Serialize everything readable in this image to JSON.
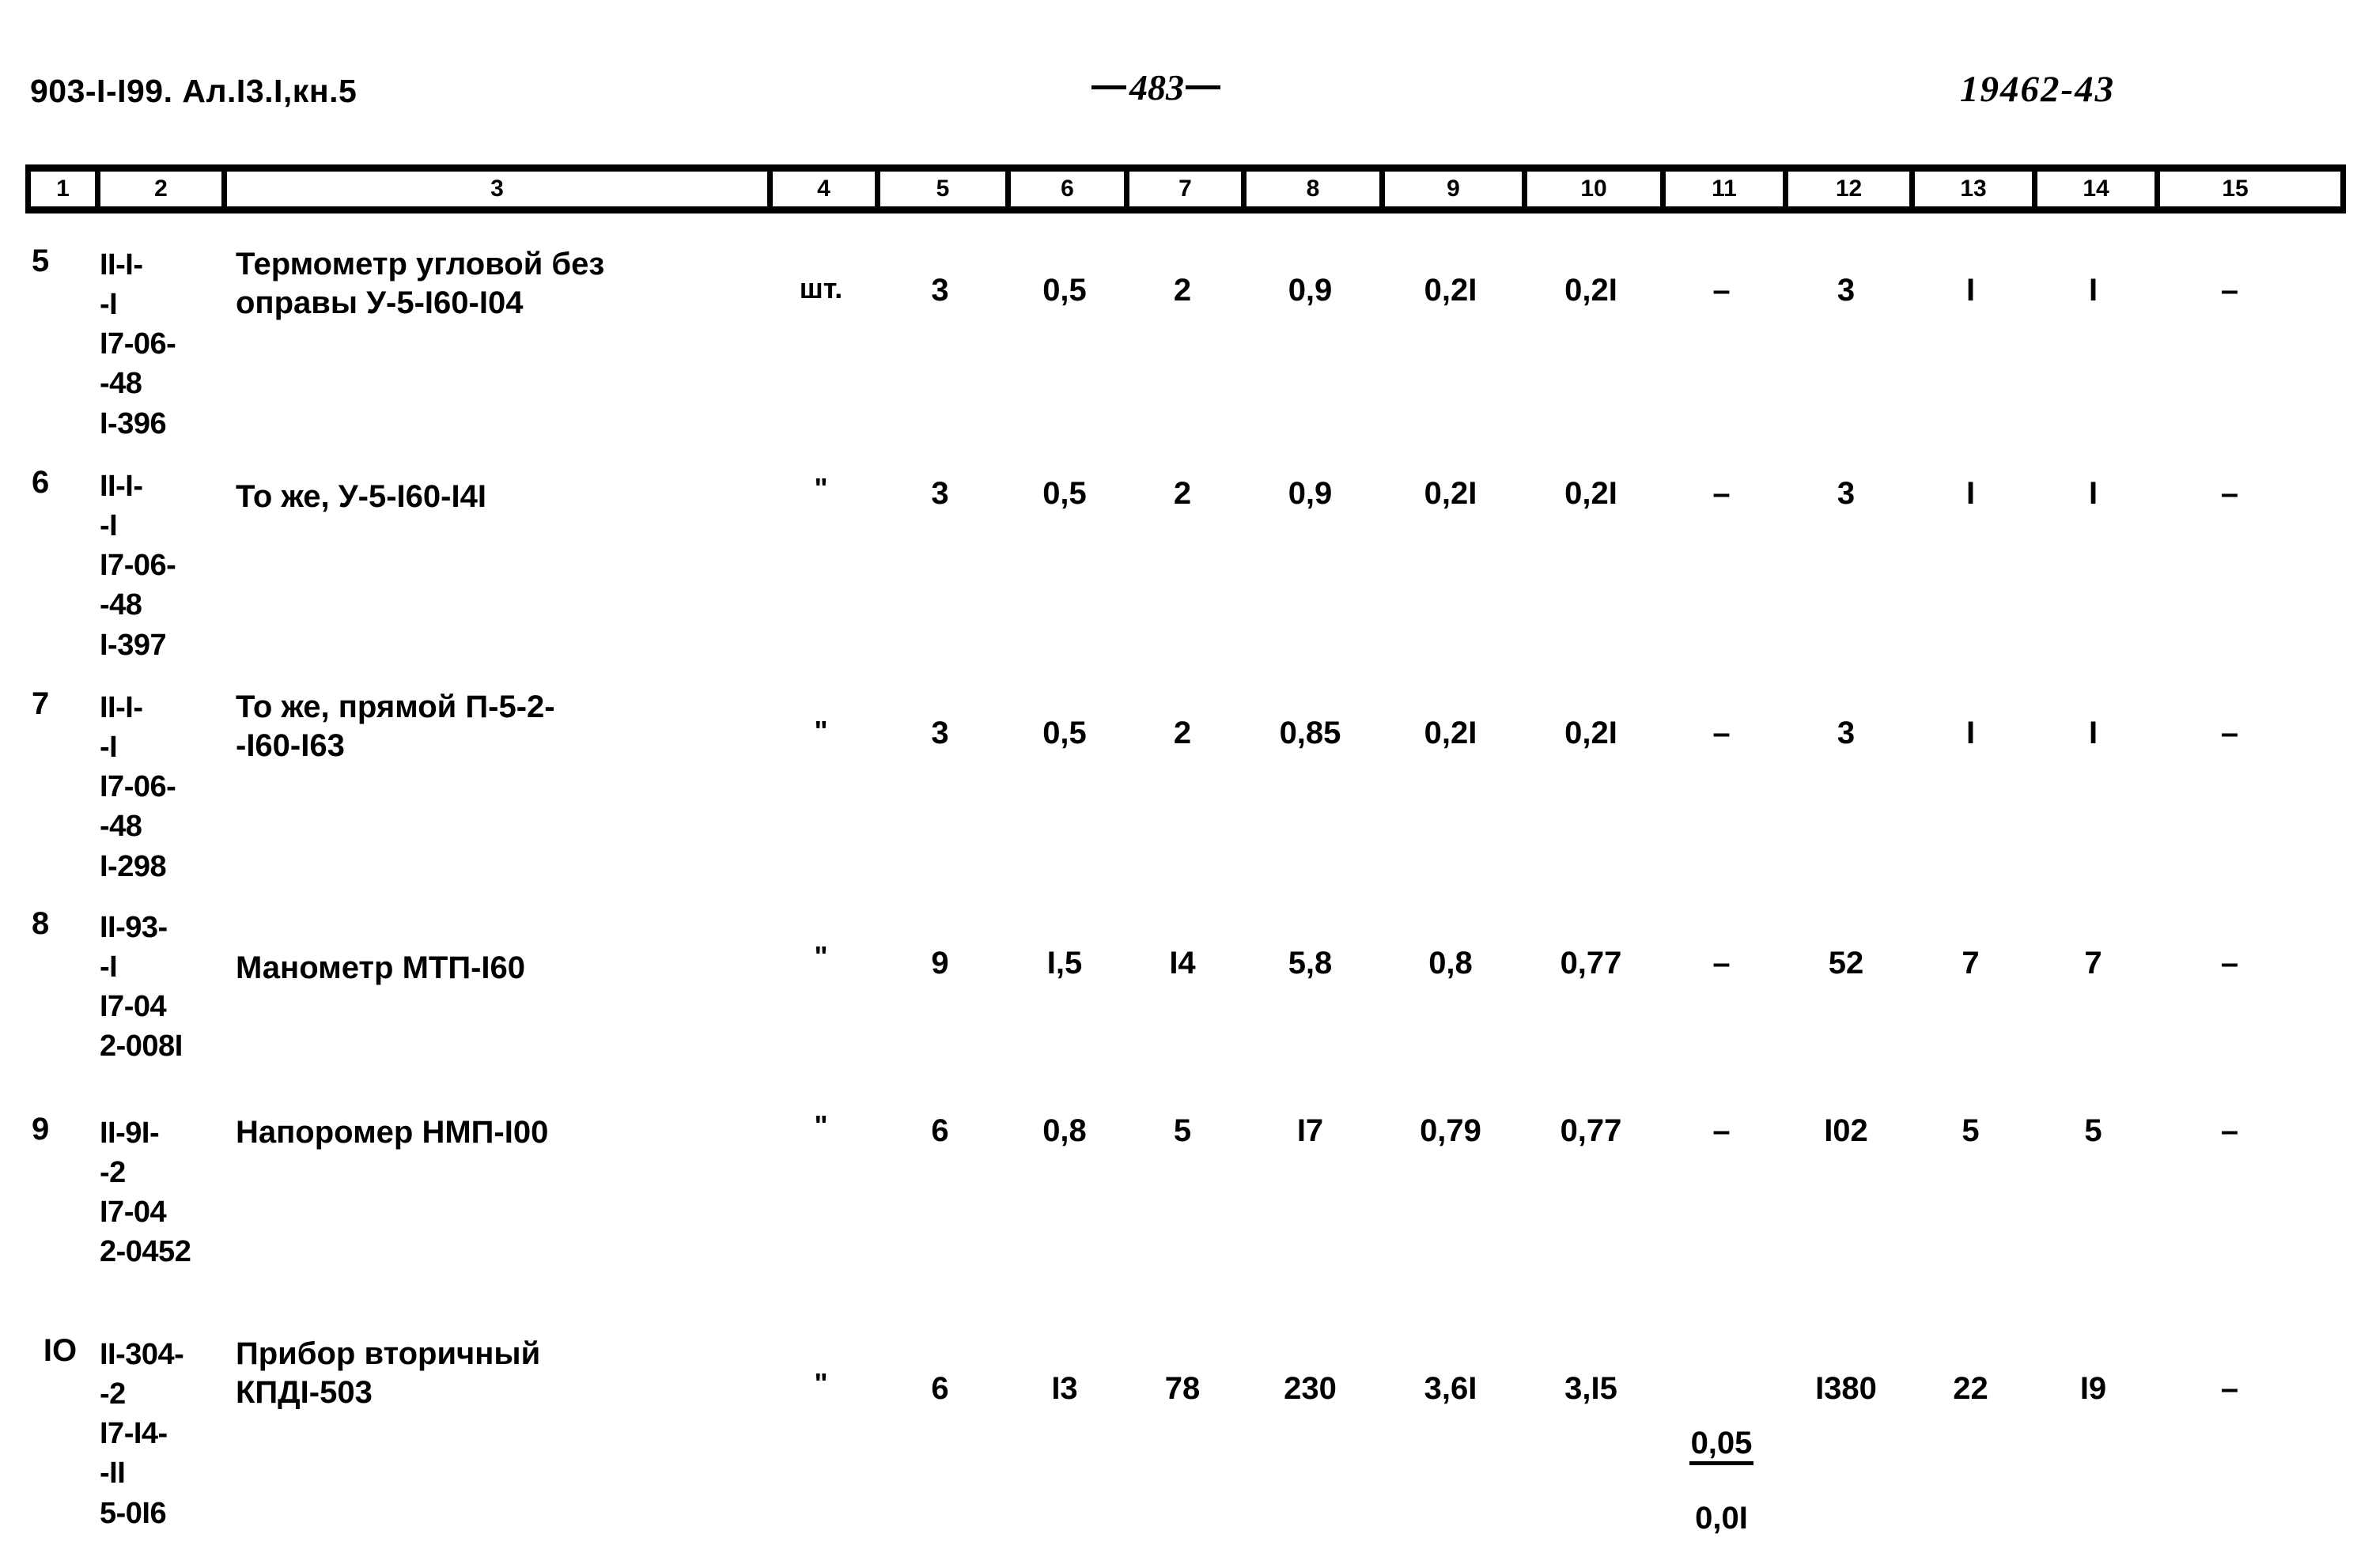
{
  "header": {
    "left": "903-I-I99. Ал.I3.I,кн.5",
    "center": "483",
    "right": "19462-43"
  },
  "table": {
    "column_numbers": [
      "1",
      "2",
      "3",
      "4",
      "5",
      "6",
      "7",
      "8",
      "9",
      "10",
      "11",
      "12",
      "13",
      "14",
      "15"
    ],
    "rows": [
      {
        "pos": "5",
        "code": "II-I-\n-I\nI7-06-\n-48\nI-396",
        "name": "Термометр угловой без\nоправы У-5-I60-I04",
        "unit": "шт.",
        "c5": "3",
        "c6": "0,5",
        "c7": "2",
        "c8": "0,9",
        "c9": "0,2I",
        "c10": "0,2I",
        "c11": "–",
        "c12": "3",
        "c13": "I",
        "c14": "I",
        "c15": "–"
      },
      {
        "pos": "6",
        "code": "II-I-\n-I\nI7-06-\n-48\nI-397",
        "name": "То же, У-5-I60-I4I",
        "unit": "\"",
        "c5": "3",
        "c6": "0,5",
        "c7": "2",
        "c8": "0,9",
        "c9": "0,2I",
        "c10": "0,2I",
        "c11": "–",
        "c12": "3",
        "c13": "I",
        "c14": "I",
        "c15": "–"
      },
      {
        "pos": "7",
        "code": "II-I-\n-I\nI7-06-\n-48\nI-298",
        "name": "То же, прямой П-5-2-\n-I60-I63",
        "unit": "\"",
        "c5": "3",
        "c6": "0,5",
        "c7": "2",
        "c8": "0,85",
        "c9": "0,2I",
        "c10": "0,2I",
        "c11": "–",
        "c12": "3",
        "c13": "I",
        "c14": "I",
        "c15": "–"
      },
      {
        "pos": "8",
        "code": "II-93-\n-I\nI7-04\n2-008I",
        "name": "Манометр МТП-I60",
        "unit": "\"",
        "c5": "9",
        "c6": "I,5",
        "c7": "I4",
        "c8": "5,8",
        "c9": "0,8",
        "c10": "0,77",
        "c11": "–",
        "c12": "52",
        "c13": "7",
        "c14": "7",
        "c15": "–"
      },
      {
        "pos": "9",
        "code": "II-9I-\n-2\nI7-04\n2-0452",
        "name": "Напоромер НМП-I00",
        "unit": "\"",
        "c5": "6",
        "c6": "0,8",
        "c7": "5",
        "c8": "I7",
        "c9": "0,79",
        "c10": "0,77",
        "c11": "–",
        "c12": "I02",
        "c13": "5",
        "c14": "5",
        "c15": "–"
      },
      {
        "pos": "IO",
        "code": "II-304-\n-2\nI7-I4-\n-II\n5-0I6",
        "name": "Прибор вторичный\nКПДI-503",
        "unit": "\"",
        "c5": "6",
        "c6": "I3",
        "c7": "78",
        "c8": "230",
        "c9": "3,6I",
        "c10": "3,I5",
        "c11_numerator": "0,05",
        "c11_denominator": "0,0I",
        "c12": "I380",
        "c13": "22",
        "c14": "I9",
        "c15": "–"
      }
    ]
  }
}
